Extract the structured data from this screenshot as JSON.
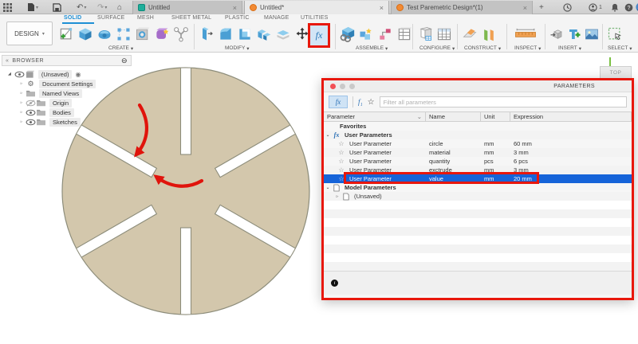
{
  "icons": {
    "caret_down": "▾",
    "chevron_down": "⌄",
    "chevron_right": "▹",
    "tree_corner": "◢",
    "star_outline": "☆",
    "collapse_circle": "⊖",
    "close": "×",
    "add_tab": "+",
    "info": "i",
    "badge_count": "1",
    "gear": "⚙",
    "target": "◉",
    "double_arrow": "«"
  },
  "titlebar": {
    "tabs": [
      {
        "label": "Untitled"
      },
      {
        "label": "Untitled*"
      },
      {
        "label": "Test Paremetric Design*(1)"
      }
    ]
  },
  "ribbon": {
    "design_label": "DESIGN",
    "tabs": [
      "SOLID",
      "SURFACE",
      "MESH",
      "SHEET METAL",
      "PLASTIC",
      "MANAGE",
      "UTILITIES"
    ],
    "active_tab": "SOLID",
    "groups": [
      "CREATE",
      "MODIFY",
      "ASSEMBLE",
      "CONFIGURE",
      "CONSTRUCT",
      "INSPECT",
      "INSERT",
      "SELECT"
    ],
    "fx_label": "fx"
  },
  "browser": {
    "title": "BROWSER",
    "root_label": "(Unsaved)",
    "items": [
      "Document Settings",
      "Named Views",
      "Origin",
      "Bodies",
      "Sketches"
    ]
  },
  "viewcube": {
    "top": "TOP"
  },
  "dialog": {
    "title": "PARAMETERS",
    "fx_label": "fx",
    "f1_label": "f₁",
    "filter_placeholder": "Filter all parameters",
    "columns": [
      "Parameter",
      "Name",
      "Unit",
      "Expression"
    ],
    "favorites": "Favorites",
    "user_parameters": "User Parameters",
    "model_parameters": "Model Parameters",
    "model_child": "(Unsaved)",
    "rows": [
      {
        "parameter": "User Parameter",
        "name": "circle",
        "unit": "mm",
        "expression": "60 mm"
      },
      {
        "parameter": "User Parameter",
        "name": "material",
        "unit": "mm",
        "expression": "3 mm"
      },
      {
        "parameter": "User Parameter",
        "name": "quantity",
        "unit": "pcs",
        "expression": "6 pcs"
      },
      {
        "parameter": "User Parameter",
        "name": "exctrude",
        "unit": "mm",
        "expression": "3 mm"
      },
      {
        "parameter": "User Parameter",
        "name": "value",
        "unit": "mm",
        "expression": "20 mm",
        "selected": true
      }
    ]
  },
  "colors": {
    "annotation_red": "#e8170c",
    "selection_blue": "#1664d9",
    "accent_blue": "#1e8fd5",
    "disc_fill": "#d3c7ac"
  }
}
